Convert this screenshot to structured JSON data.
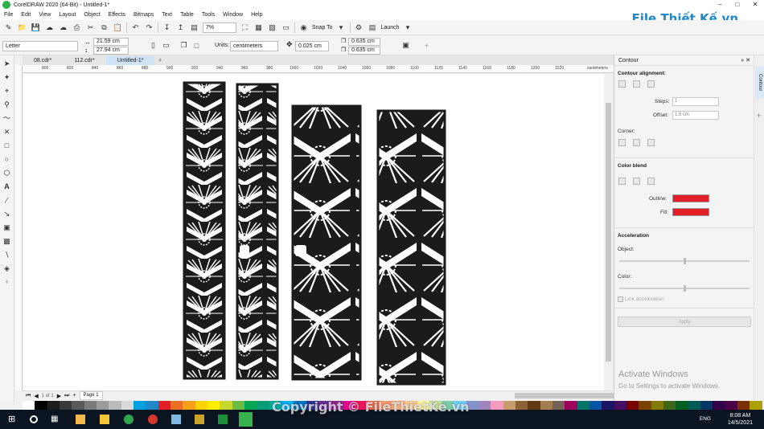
{
  "app": {
    "title": "CorelDRAW 2020 (64-Bit) - Untitled-1*",
    "brand_watermark": "File Thiết Kế.vn",
    "copyright_watermark": "Copyright © FileThietKe.vn"
  },
  "menu": [
    "File",
    "Edit",
    "View",
    "Layout",
    "Object",
    "Effects",
    "Bitmaps",
    "Text",
    "Table",
    "Tools",
    "Window",
    "Help"
  ],
  "toolbar": {
    "zoom": "7%",
    "snap_to": "Snap To",
    "launch": "Launch"
  },
  "propbar": {
    "page_size": "Letter",
    "width": "21.59 cm",
    "height": "27.94 cm",
    "units_label": "Units:",
    "units": "centimeters",
    "nudge": "0.025 cm",
    "dup_x": "0.635 cm",
    "dup_y": "0.635 cm"
  },
  "tabs": [
    "08.cdr*",
    "112.cdr*",
    "Untitled-1*"
  ],
  "ruler": {
    "labels": [
      "800",
      "820",
      "840",
      "860",
      "880",
      "900",
      "920",
      "940",
      "960",
      "980",
      "1000",
      "1020",
      "1040",
      "1060",
      "1080",
      "1100",
      "1120",
      "1140",
      "1160",
      "1180",
      "1200",
      "1220"
    ],
    "unit": "centimeters"
  },
  "pagenav": {
    "counter": "1 of 1",
    "page_tab": "Page 1"
  },
  "docker": {
    "title": "Contour",
    "alignment": "Contour alignment:",
    "steps_label": "Steps:",
    "steps": "1",
    "offset_label": "Offset:",
    "offset": "1.5 cm",
    "corner": "Corner:",
    "color_blend": "Color blend",
    "outline_label": "Outline:",
    "fill_label": "Fill:",
    "acceleration": "Acceleration",
    "object_label": "Object:",
    "color_label": "Color:",
    "link": "Link acceleration",
    "apply": "Apply",
    "side_tab": "Contour",
    "swatch_color": "#e21e26"
  },
  "activation": {
    "line1": "Activate Windows",
    "line2": "Go to Settings to activate Windows."
  },
  "taskbar": {
    "lang": "ENG",
    "time": "8:08 AM",
    "date": "14/5/2021"
  },
  "palette": [
    "#ffffff",
    "#000000",
    "#1c1c1c",
    "#3a3a3a",
    "#5a5a5a",
    "#7a7a7a",
    "#9a9a9a",
    "#bababa",
    "#dadada",
    "#00a0e0",
    "#1e88c9",
    "#e21e26",
    "#ec6e24",
    "#f6a01a",
    "#ffd200",
    "#ffed00",
    "#c5d82b",
    "#6cbd45",
    "#00a651",
    "#009b77",
    "#00a99d",
    "#00aeef",
    "#0072bc",
    "#2e3192",
    "#662d91",
    "#92278f",
    "#ec008c",
    "#ed145b",
    "#f26c4f",
    "#f7976a",
    "#fbad82",
    "#fdc68a",
    "#fff799",
    "#c4df9b",
    "#7bcda6",
    "#6dcff6",
    "#8493ca",
    "#a186be",
    "#f49ac1",
    "#c69c6d",
    "#8c6239",
    "#603913",
    "#a67c52",
    "#736357",
    "#9e005d",
    "#00746b",
    "#0054a6",
    "#1b1464",
    "#440e62",
    "#790000",
    "#7a4100",
    "#827b00",
    "#406618",
    "#005e20",
    "#005952",
    "#003663",
    "#32004b",
    "#4b0049",
    "#7b2e00",
    "#aba000"
  ]
}
